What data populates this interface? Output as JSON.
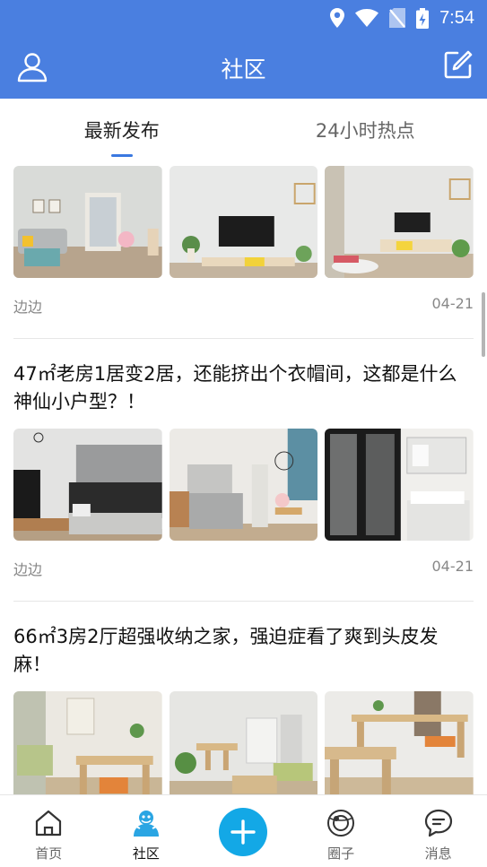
{
  "status": {
    "time": "7:54"
  },
  "header": {
    "title": "社区"
  },
  "tabs": [
    {
      "label": "最新发布",
      "active": true
    },
    {
      "label": "24小时热点",
      "active": false
    }
  ],
  "posts": [
    {
      "title": "",
      "author": "边边",
      "date": "04-21"
    },
    {
      "title": "47㎡老房1居变2居，还能挤出个衣帽间，这都是什么神仙小户型？！",
      "author": "边边",
      "date": "04-21"
    },
    {
      "title": "66㎡3房2厅超强收纳之家，强迫症看了爽到头皮发麻！",
      "author": "",
      "date": ""
    }
  ],
  "nav": [
    {
      "label": "首页",
      "icon": "home-icon"
    },
    {
      "label": "社区",
      "icon": "community-icon",
      "active": true
    },
    {
      "label": "",
      "icon": "plus-icon"
    },
    {
      "label": "圈子",
      "icon": "circle-icon"
    },
    {
      "label": "消息",
      "icon": "message-icon"
    }
  ],
  "colors": {
    "primary": "#4a7fe0",
    "fab": "#13a8e6",
    "indicator": "#3a78e0"
  }
}
